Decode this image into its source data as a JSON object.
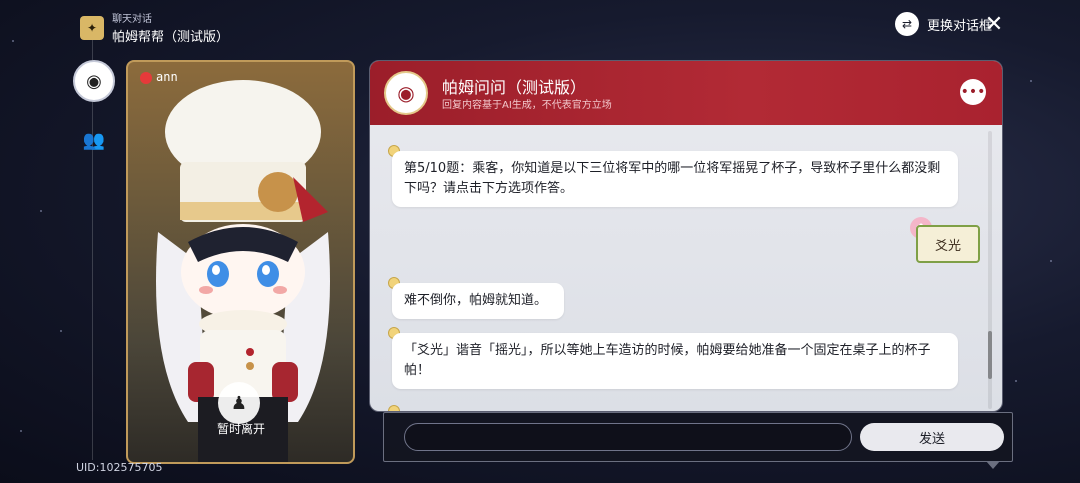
{
  "header": {
    "subtitle": "聊天对话",
    "title": "帕姆帮帮（测试版）",
    "swap_label": "更换对话框",
    "icons": {
      "app": "badge-icon",
      "swap": "swap-dialog-icon",
      "close": "close-icon"
    }
  },
  "rail": {
    "icons": [
      "pom-avatar-icon",
      "people-icon"
    ]
  },
  "card": {
    "rec_label": "ann",
    "leave_label": "暂时离开",
    "icons": {
      "rec": "record-dot-icon",
      "leave": "leave-icon"
    },
    "colors": {
      "border": "#c09a5a",
      "rec": "#e63a3a"
    }
  },
  "uid": "UID:102575705",
  "chat": {
    "title": "帕姆问问（测试版）",
    "subtitle": "回复内容基于AI生成，不代表官方立场",
    "messages": [
      {
        "from": "bot",
        "text": "第5/10题：乘客，你知道是以下三位将军中的哪一位将军摇晃了杯子，导致杯子里什么都没剩下吗？请点击下方选项作答。"
      },
      {
        "from": "user",
        "text": "爻光"
      },
      {
        "from": "bot",
        "text": "难不倒你，帕姆就知道。"
      },
      {
        "from": "bot",
        "text": "「爻光」谐音「摇光」，所以等她上车造访的时候，帕姆要给她准备一个固定在桌子上的杯子帕！"
      }
    ],
    "icons": {
      "avatar": "pom-avatar-icon",
      "more": "more-icon",
      "message_dot": "message-dot-icon",
      "sticker": "bunny-icon"
    },
    "colors": {
      "header": "#9b1e2a",
      "bubble": "#ffffff"
    }
  },
  "input": {
    "value": "",
    "placeholder": "",
    "send_label": "发送"
  }
}
